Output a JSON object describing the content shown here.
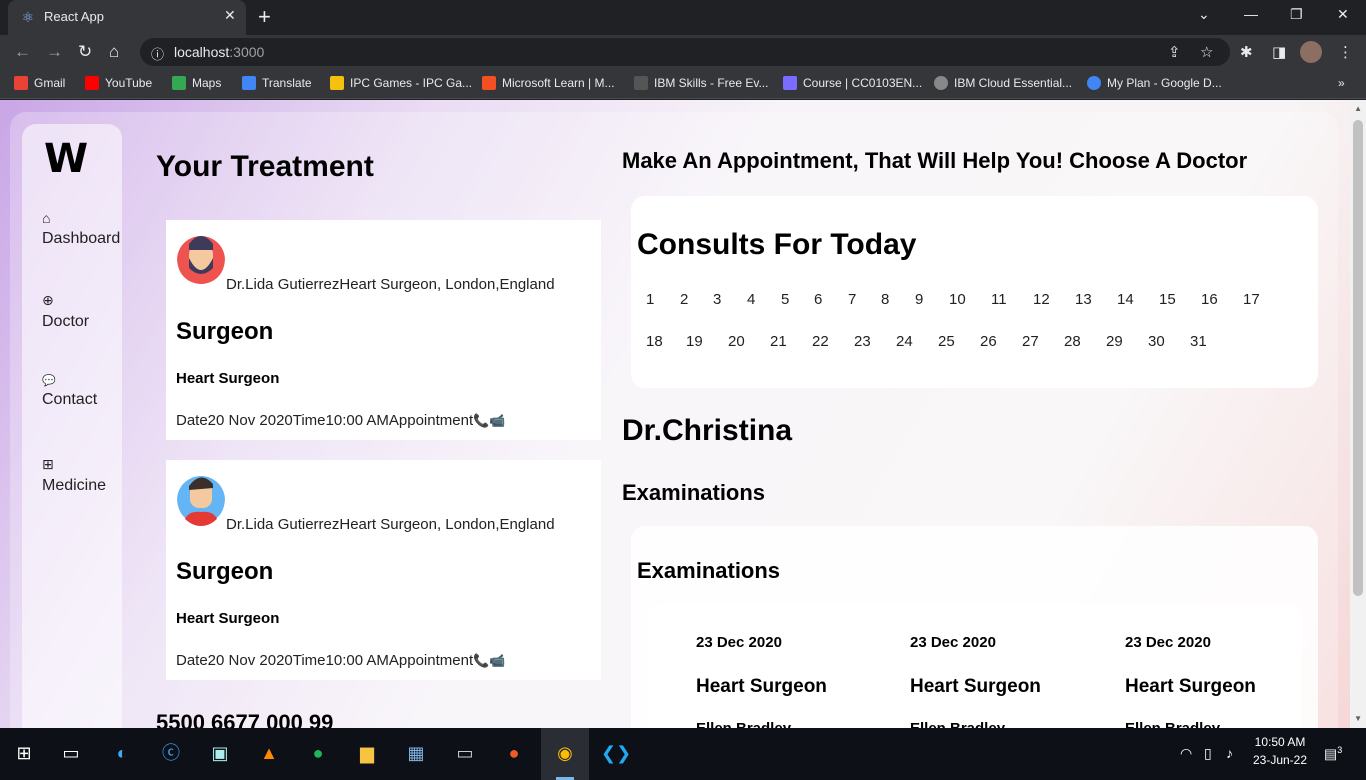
{
  "browser": {
    "tab_title": "React App",
    "tab_close": "✕",
    "new_tab": "+",
    "url_host": "localhost",
    "url_port": ":3000",
    "bookmarks": [
      {
        "label": "Gmail",
        "color": "#ea4335"
      },
      {
        "label": "YouTube",
        "color": "#ff0000"
      },
      {
        "label": "Maps",
        "color": "#34a853"
      },
      {
        "label": "Translate",
        "color": "#4285f4"
      },
      {
        "label": "IPC Games - IPC Ga...",
        "color": "#f4c20d"
      },
      {
        "label": "Microsoft Learn | M...",
        "color": "#f25022"
      },
      {
        "label": "IBM Skills - Free Ev...",
        "color": "#555555"
      },
      {
        "label": "Course | CC0103EN...",
        "color": "#7a6cff"
      },
      {
        "label": "IBM Cloud Essential...",
        "color": "#888888"
      },
      {
        "label": "My Plan - Google D...",
        "color": "#4285f4"
      }
    ]
  },
  "sidebar": {
    "logo": "W",
    "items": [
      {
        "label": "Dashboard",
        "icon": "home-icon",
        "glyph": "⌂"
      },
      {
        "label": "Doctor",
        "icon": "plus-circle-icon",
        "glyph": "⊕"
      },
      {
        "label": "Contact",
        "icon": "chat-icon",
        "glyph": "💬"
      },
      {
        "label": "Medicine",
        "icon": "medkit-icon",
        "glyph": "⊞"
      }
    ]
  },
  "treatment": {
    "title": "Your Treatment",
    "cards": [
      {
        "doctor": "Dr.Lida GutierrezHeart Surgeon, London,England",
        "role": "Surgeon",
        "spec": "Heart Surgeon",
        "meta": "Date20 Nov 2020Time10:00 AMAppointment",
        "avatar_color": "#ef5350"
      },
      {
        "doctor": "Dr.Lida GutierrezHeart Surgeon, London,England",
        "role": "Surgeon",
        "spec": "Heart Surgeon",
        "meta": "Date20 Nov 2020Time10:00 AMAppointment",
        "avatar_color": "#64b5f6"
      }
    ],
    "price": "5500 6677 000 99"
  },
  "appointment": {
    "title": "Make An Appointment, That Will Help You! Choose A Doctor",
    "consult_title": "Consults For Today",
    "days": [
      "1",
      "2",
      "3",
      "4",
      "5",
      "6",
      "7",
      "8",
      "9",
      "10",
      "11",
      "12",
      "13",
      "14",
      "15",
      "16",
      "17",
      "18",
      "19",
      "20",
      "21",
      "22",
      "23",
      "24",
      "25",
      "26",
      "27",
      "28",
      "29",
      "30",
      "31"
    ]
  },
  "doctor": {
    "name": "Dr.Christina",
    "exam_heading": "Examinations",
    "exam_box_title": "Examinations",
    "exams": [
      {
        "date": "23 Dec 2020",
        "spec": "Heart Surgeon",
        "extra": "Ellen Bradley"
      },
      {
        "date": "23 Dec 2020",
        "spec": "Heart Surgeon",
        "extra": "Ellen Bradley"
      },
      {
        "date": "23 Dec 2020",
        "spec": "Heart Surgeon",
        "extra": "Ellen Bradley"
      }
    ]
  },
  "taskbar": {
    "time": "10:50 AM",
    "date": "23-Jun-22",
    "notifications": "3"
  }
}
